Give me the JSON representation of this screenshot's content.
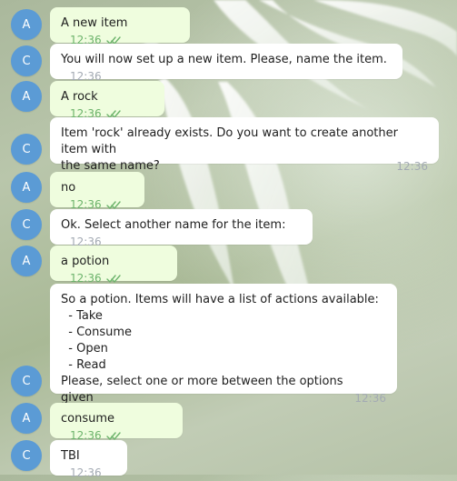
{
  "colors": {
    "avatar_background": "#5b9bd5",
    "outgoing_bubble": "#effdde",
    "incoming_bubble": "#ffffff",
    "outgoing_time": "#6cb36b",
    "incoming_time": "#a3aab3"
  },
  "messages": [
    {
      "avatar": "A",
      "text": "A new item",
      "time": "12:36",
      "direction": "out",
      "read": true
    },
    {
      "avatar": "C",
      "text": "You will now set up a new item. Please, name the item.",
      "time": "12:36",
      "direction": "in"
    },
    {
      "avatar": "A",
      "text": "A rock",
      "time": "12:36",
      "direction": "out",
      "read": true
    },
    {
      "avatar": "C",
      "text_lines": [
        "Item 'rock' already exists. Do you want to create another item with",
        "the same name?"
      ],
      "time": "12:36",
      "direction": "in"
    },
    {
      "avatar": "A",
      "text": "no",
      "time": "12:36",
      "direction": "out",
      "read": true
    },
    {
      "avatar": "C",
      "text": "Ok. Select another name for the item:",
      "time": "12:36",
      "direction": "in"
    },
    {
      "avatar": "A",
      "text": "a potion",
      "time": "12:36",
      "direction": "out",
      "read": true
    },
    {
      "avatar": "C",
      "text_lines": [
        "So a potion. Items will have a list of actions available:",
        "  - Take",
        "  - Consume",
        "  - Open",
        "  - Read",
        "Please, select one or more between the options given"
      ],
      "time": "12:36",
      "direction": "in"
    },
    {
      "avatar": "A",
      "text": "consume",
      "time": "12:36",
      "direction": "out",
      "read": true
    },
    {
      "avatar": "C",
      "text": "TBI",
      "time": "12:36",
      "direction": "in"
    }
  ]
}
